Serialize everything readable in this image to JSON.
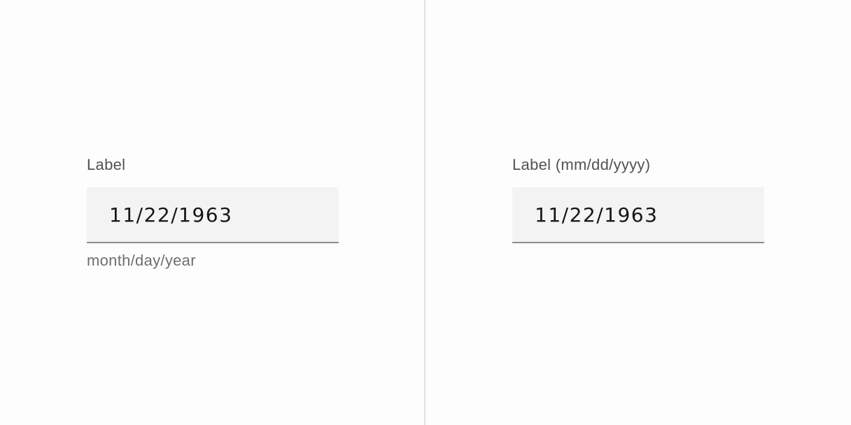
{
  "left_example": {
    "label": "Label",
    "value": "11/22/1963",
    "helper_text": "month/day/year"
  },
  "right_example": {
    "label": "Label (mm/dd/yyyy)",
    "value": "11/22/1963"
  },
  "colors": {
    "field_background": "#f3f3f3",
    "field_underline": "#8d8d8d",
    "label_text": "#525252",
    "helper_text": "#6f6f6f",
    "value_text": "#161616",
    "divider": "#e0e0e0"
  }
}
